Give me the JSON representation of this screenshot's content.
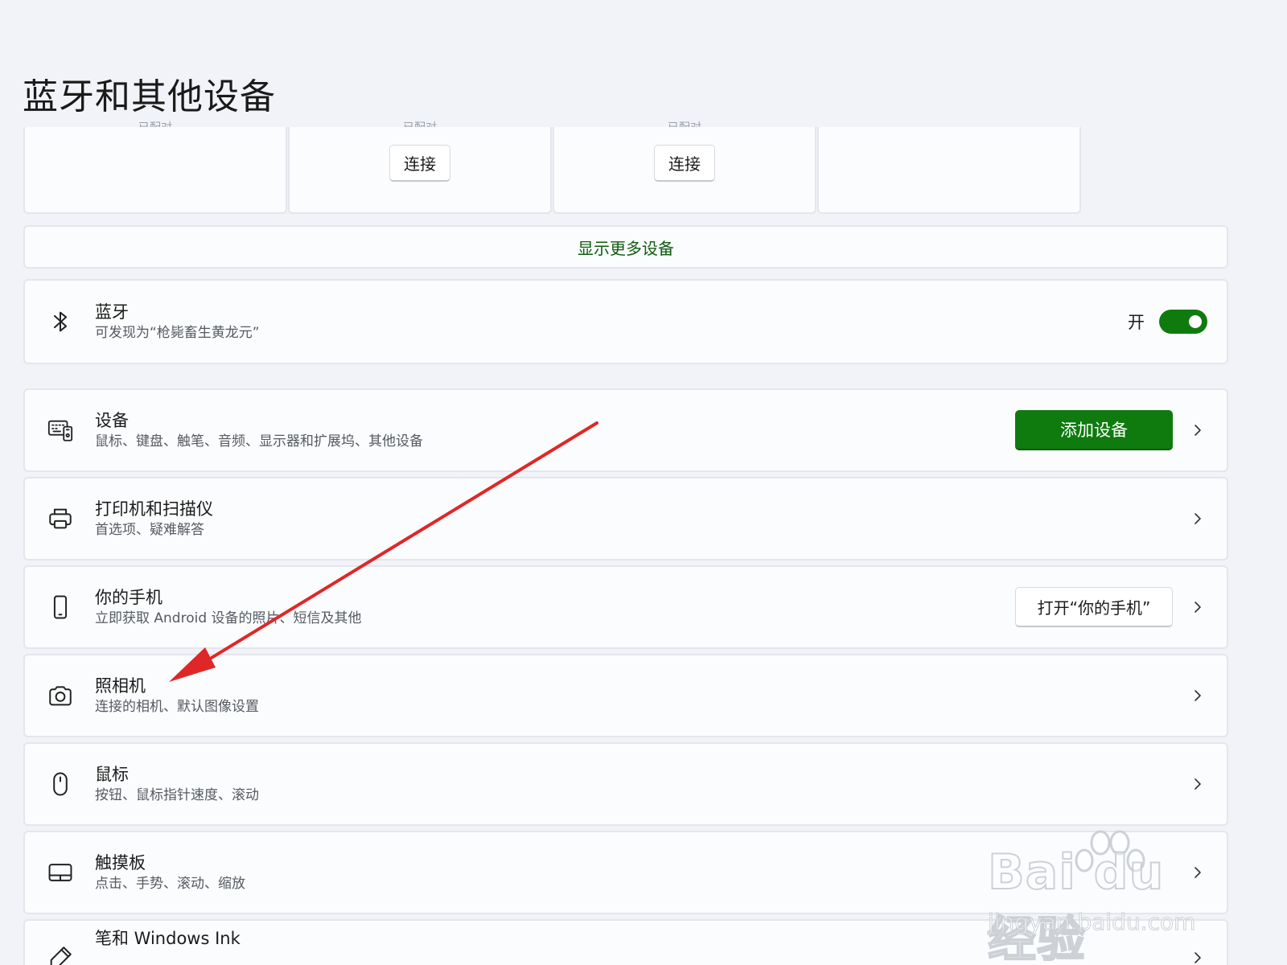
{
  "page": {
    "title": "蓝牙和其他设备"
  },
  "device_cards": [
    {
      "cut_text": "已配对",
      "connect_label": ""
    },
    {
      "cut_text": "已配对",
      "connect_label": "连接"
    },
    {
      "cut_text": "已配对",
      "connect_label": "连接"
    },
    {
      "cut_text": "",
      "connect_label": ""
    }
  ],
  "show_more": {
    "label": "显示更多设备"
  },
  "bluetooth": {
    "title": "蓝牙",
    "subtitle": "可发现为“枪毙畜生黄龙元”",
    "state_label": "开",
    "enabled": true
  },
  "rows": {
    "devices": {
      "title": "设备",
      "subtitle": "鼠标、键盘、触笔、音频、显示器和扩展坞、其他设备",
      "button_label": "添加设备"
    },
    "printers": {
      "title": "打印机和扫描仪",
      "subtitle": "首选项、疑难解答"
    },
    "phone": {
      "title": "你的手机",
      "subtitle": "立即获取 Android 设备的照片、短信及其他",
      "button_label": "打开“你的手机”"
    },
    "camera": {
      "title": "照相机",
      "subtitle": "连接的相机、默认图像设置"
    },
    "mouse": {
      "title": "鼠标",
      "subtitle": "按钮、鼠标指针速度、滚动"
    },
    "touchpad": {
      "title": "触摸板",
      "subtitle": "点击、手势、滚动、缩放"
    },
    "pen": {
      "title": "笔和 Windows Ink",
      "subtitle": ""
    }
  },
  "annotation": {
    "arrow_color": "#e02727"
  },
  "watermark": {
    "logo_text": "Bai du 经验",
    "url": "jingyan.baidu.com"
  },
  "colors": {
    "accent": "#0f7b0f",
    "background": "#f1f3f8",
    "card": "#fbfcfe"
  }
}
